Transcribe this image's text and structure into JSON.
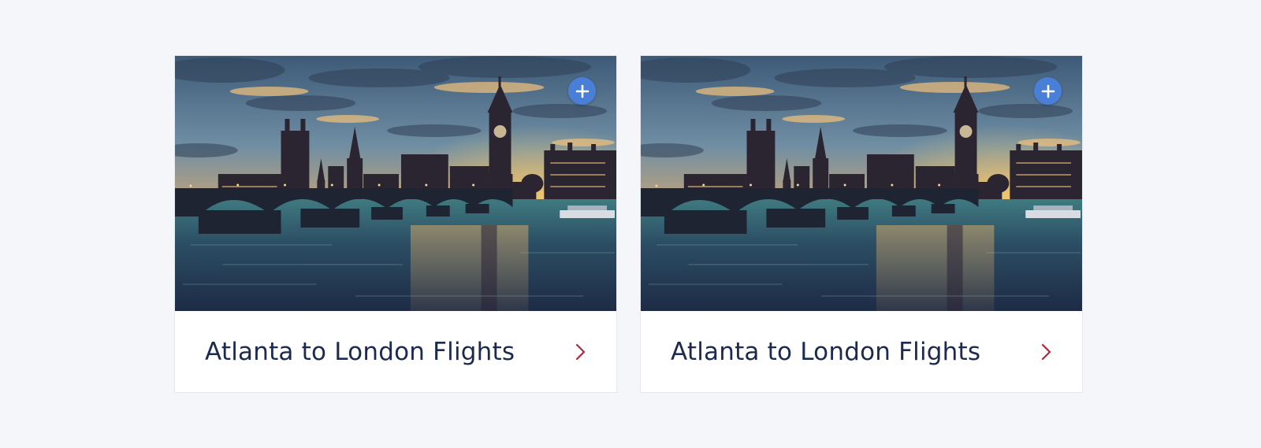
{
  "colors": {
    "background": "#f5f6fa",
    "card": "#ffffff",
    "title_text": "#1b2a4e",
    "add_button": "#4a7fd8",
    "chevron": "#b3263f"
  },
  "cards": [
    {
      "title": "Atlanta to London Flights",
      "image": "london-westminster-sunset",
      "add_icon": "plus-icon",
      "arrow_icon": "chevron-right-icon"
    },
    {
      "title": "Atlanta to London Flights",
      "image": "london-westminster-sunset",
      "add_icon": "plus-icon",
      "arrow_icon": "chevron-right-icon"
    }
  ]
}
